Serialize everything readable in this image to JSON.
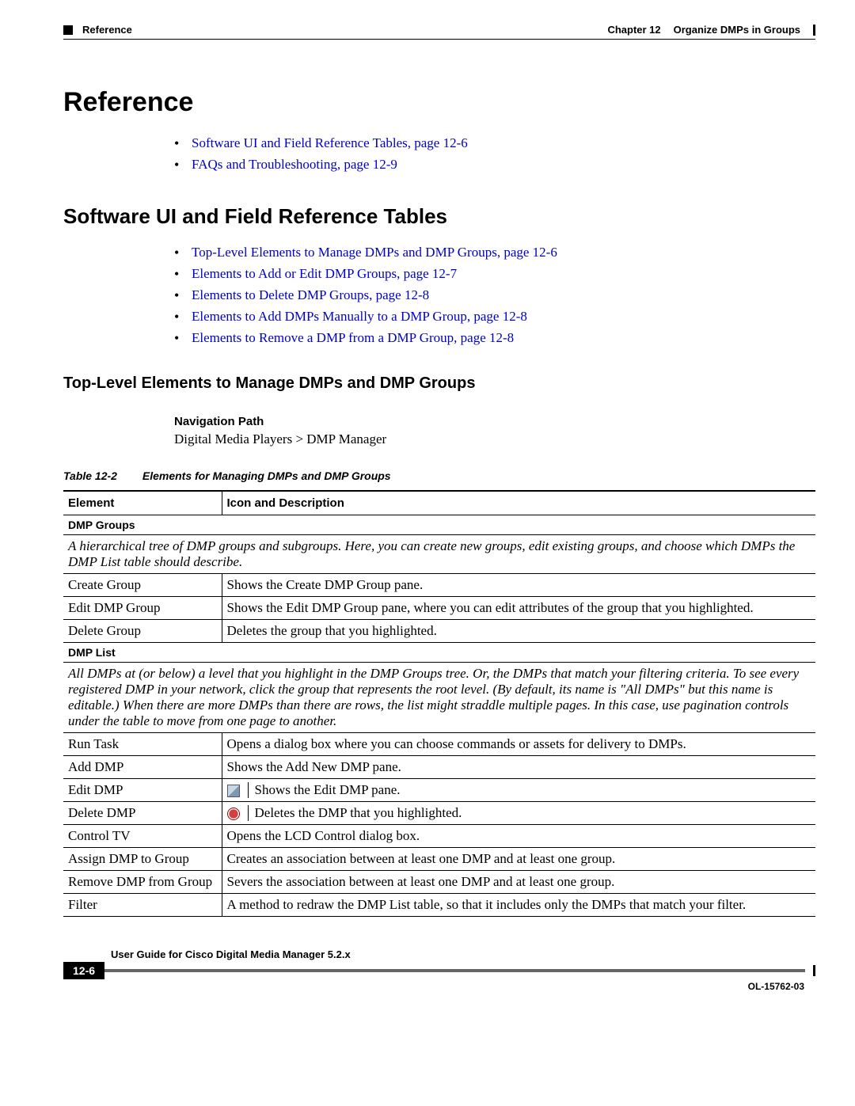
{
  "header": {
    "left_label": "Reference",
    "chapter": "Chapter 12",
    "chapter_title": "Organize DMPs in Groups"
  },
  "h1": "Reference",
  "links_main": [
    "Software UI and Field Reference Tables, page 12-6",
    "FAQs and Troubleshooting, page 12-9"
  ],
  "h2": "Software UI and Field Reference Tables",
  "links_sub": [
    "Top-Level Elements to Manage DMPs and DMP Groups, page 12-6",
    "Elements to Add or Edit DMP Groups, page 12-7",
    "Elements to Delete DMP Groups, page 12-8",
    "Elements to Add DMPs Manually to a DMP Group, page 12-8",
    "Elements to Remove a DMP from a DMP Group, page 12-8"
  ],
  "h3": "Top-Level Elements to Manage DMPs and DMP Groups",
  "nav": {
    "label": "Navigation Path",
    "path": "Digital Media Players > DMP Manager"
  },
  "table_caption": {
    "num": "Table 12-2",
    "title": "Elements for Managing DMPs and DMP Groups"
  },
  "table_headers": {
    "col1": "Element",
    "col2": "Icon and Description"
  },
  "sections": [
    {
      "name": "DMP Groups",
      "desc": "A hierarchical tree of DMP groups and subgroups. Here, you can create new groups, edit existing groups, and choose which DMPs the DMP List table should describe.",
      "rows": [
        {
          "el": "Create Group",
          "txt": "Shows the Create DMP Group pane."
        },
        {
          "el": "Edit DMP Group",
          "txt": "Shows the Edit DMP Group pane, where you can edit attributes of the group that you highlighted."
        },
        {
          "el": "Delete Group",
          "txt": "Deletes the group that you highlighted."
        }
      ]
    },
    {
      "name": "DMP List",
      "desc": "All DMPs at (or below) a level that you highlight in the DMP Groups tree. Or, the DMPs that match your filtering criteria. To see every registered DMP in your network, click the group that represents the root level. (By default, its name is \"All DMPs\" but this name is editable.) When there are more DMPs than there are rows, the list might straddle multiple pages. In this case, use pagination controls under the table to move from one page to another.",
      "rows": [
        {
          "el": "Run Task",
          "txt": "Opens a dialog box where you can choose commands or assets for delivery to DMPs."
        },
        {
          "el": "Add DMP",
          "txt": "Shows the Add New DMP pane."
        },
        {
          "el": "Edit DMP",
          "icon": "edit",
          "txt": "Shows the Edit DMP pane."
        },
        {
          "el": "Delete DMP",
          "icon": "delete",
          "txt": "Deletes the DMP that you highlighted."
        },
        {
          "el": "Control TV",
          "txt": "Opens the LCD Control dialog box."
        },
        {
          "el": "Assign DMP to Group",
          "txt": "Creates an association between at least one DMP and at least one group."
        },
        {
          "el": "Remove DMP from Group",
          "txt": "Severs the association between at least one DMP and at least one group."
        },
        {
          "el": "Filter",
          "txt": "A method to redraw the DMP List table, so that it includes only the DMPs that match your filter."
        }
      ]
    }
  ],
  "footer": {
    "guide": "User Guide for Cisco Digital Media Manager 5.2.x",
    "page": "12-6",
    "code": "OL-15762-03"
  }
}
